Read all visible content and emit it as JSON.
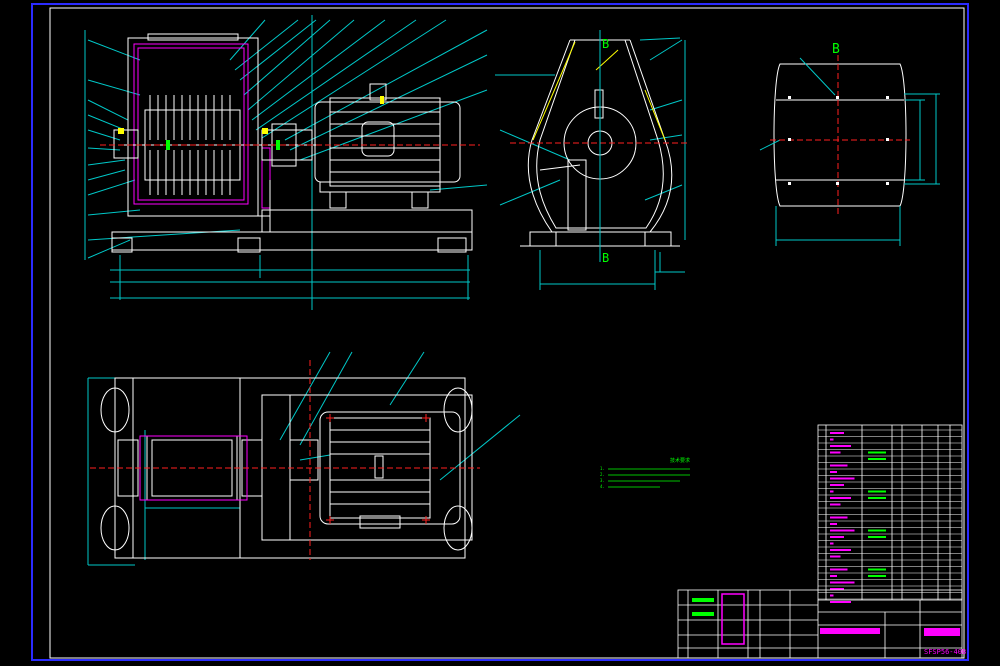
{
  "drawing": {
    "title_code": "SFSP56-40B",
    "section_label_top": "B",
    "section_label_bottom": "B",
    "tech_notes_heading": "技术要求",
    "tech_notes": [
      "1.",
      "2.",
      "3.",
      "4."
    ]
  },
  "colors": {
    "background": "#000000",
    "outline": "#ffffff",
    "border_blue": "#2b2bff",
    "part_magenta": "#ff00ff",
    "leader_cyan": "#00c8c8",
    "center_red": "#ff2020",
    "accent_yellow": "#ffff00",
    "accent_green": "#00ff00"
  },
  "icons": {
    "hammer_mill_side": "side-elevation-view",
    "hammer_mill_end": "end-section-view",
    "screen_view": "screen-detail-view-B",
    "plan_view": "top-plan-view",
    "bom": "bill-of-materials-table",
    "title_block": "title-block"
  }
}
